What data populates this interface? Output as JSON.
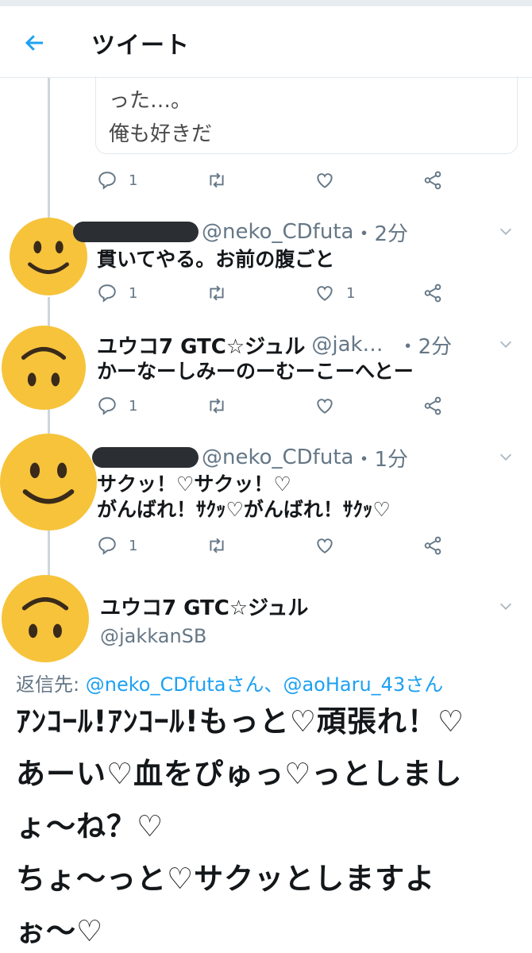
{
  "header": {
    "title": "ツイート"
  },
  "quoted_lines": [
    "った…。",
    "俺も好きだ"
  ],
  "colors": {
    "accent": "#1da1f2",
    "avatar": "#f6c33b",
    "muted": "#657786"
  },
  "tweets": [
    {
      "actions": {
        "reply": "1",
        "retweet": "",
        "like": "",
        "share": ""
      }
    },
    {
      "name": "",
      "handle": "@neko_CDfuta",
      "time": "・2分",
      "text": [
        "貫いてやる。お前の腹ごと"
      ],
      "avatar_face": "smile",
      "actions": {
        "reply": "1",
        "retweet": "",
        "like": "1"
      }
    },
    {
      "name": "ユウコ7 GTC☆ジュル",
      "handle": "@jak…",
      "time": "・2分",
      "text": [
        "かーなーしみーのーむーこーへとー"
      ],
      "avatar_face": "upside-down",
      "actions": {
        "reply": "1",
        "retweet": "",
        "like": ""
      }
    },
    {
      "name": "",
      "handle": "@neko_CDfuta",
      "time": "・1分",
      "text": [
        "サクッ！♡サクッ！♡",
        "がんばれ！ｻｸｯ♡がんばれ！ｻｸｯ♡"
      ],
      "avatar_face": "smile",
      "actions": {
        "reply": "1",
        "retweet": "",
        "like": ""
      }
    }
  ],
  "main_tweet": {
    "name": "ユウコ7 GTC☆ジュル",
    "handle": "@jakkanSB",
    "reply_label": "返信先:",
    "reply_mentions": "@neko_CDfutaさん、@aoHaru_43さん",
    "text": [
      "ｱﾝｺｰﾙ!ｱﾝｺｰﾙ!もっと♡頑張れ！♡",
      "あーい♡血をぴゅっ♡っとしまし",
      "ょ〜ね？♡",
      "ちょ〜っと♡サクッとしますよ",
      "ぉ〜♡"
    ]
  }
}
